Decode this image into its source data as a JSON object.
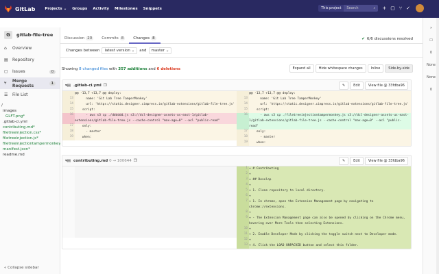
{
  "topbar": {
    "brand": "GitLab",
    "nav": [
      "Projects ⌄",
      "Groups",
      "Activity",
      "Milestones",
      "Snippets"
    ],
    "this_project": "This project",
    "search_placeholder": "Search"
  },
  "sidebar": {
    "project_initial": "G",
    "project_name": "gitlab-file-tree",
    "items": [
      {
        "label": "Overview",
        "icon": "home-icon"
      },
      {
        "label": "Repository",
        "icon": "repo-icon"
      },
      {
        "label": "Issues",
        "count": "0",
        "icon": "issues-icon"
      },
      {
        "label": "Merge Requests",
        "count": "1",
        "icon": "merge-request-icon"
      },
      {
        "label": "File List",
        "icon": "file-list-icon"
      }
    ],
    "tree": [
      {
        "name": "/"
      },
      {
        "name": "images"
      },
      {
        "name": "GLFT.png*"
      },
      {
        "name": ".gitlab-ci.yml"
      },
      {
        "name": "contributing.md*"
      },
      {
        "name": "filetreeinjection.css*"
      },
      {
        "name": "filetreeinjection.js*"
      },
      {
        "name": "filetreeinjectiontampermonkey"
      },
      {
        "name": "manifest.json*"
      },
      {
        "name": "readme.md"
      }
    ],
    "collapse": "Collapse sidebar"
  },
  "tabs": [
    {
      "label": "Discussion",
      "count": "20"
    },
    {
      "label": "Commits",
      "count": "8"
    },
    {
      "label": "Changes",
      "count": "8"
    }
  ],
  "resolved": "6/6 discussions resolved",
  "changesbar": {
    "between": "Changes between",
    "version": "latest version ⌄",
    "and": "and",
    "target": "master ⌄"
  },
  "stats": {
    "prefix": "Showing",
    "changed": "8 changed files",
    "mid": "with",
    "additions": "357 additions",
    "and": "and",
    "deletions": "6 deletions"
  },
  "buttons": {
    "expand_all": "Expand all",
    "hide_ws": "Hide whitespace changes",
    "inline": "Inline",
    "side": "Side-by-side"
  },
  "file1": {
    "name": ".gitlab-ci.yml",
    "edit": "Edit",
    "view": "View file @ 33fdba96",
    "left": [
      {
        "ln": "",
        "type": "ctx",
        "code": "@@ -13,7 +13,7 @@ deploy:"
      },
      {
        "ln": "13",
        "type": "ctx",
        "code": "      name: 'Git Lab Tree TamperMonkey'"
      },
      {
        "ln": "14",
        "type": "ctx",
        "code": "      url: 'https://static.designer.cimpress.io/gitlab-extensions/gitlab-file-tree.js'"
      },
      {
        "ln": "15",
        "type": "ctx",
        "code": "    script:"
      },
      {
        "ln": "16",
        "type": "old",
        "code": "      - aws s3 cp ./dddddd.js s3://dcl-designer-assets-us-east-1/gitlab-extensions/gitlab-file-tree.js --cache-control \"max-age=0\" --acl \"public-read\""
      },
      {
        "ln": "17",
        "type": "ctx",
        "code": "    only:"
      },
      {
        "ln": "18",
        "type": "ctx",
        "code": "      - master"
      },
      {
        "ln": "19",
        "type": "ctx",
        "code": "    when:"
      }
    ],
    "right": [
      {
        "ln": "",
        "type": "ctx",
        "code": "@@ -13,7 +13,7 @@ deploy:"
      },
      {
        "ln": "13",
        "type": "ctx",
        "code": "      name: 'Git Lab Tree TamperMonkey'"
      },
      {
        "ln": "14",
        "type": "ctx",
        "code": "      url: 'https://static.designer.cimpress.io/gitlab-extensions/gitlab-file-tree.js'"
      },
      {
        "ln": "15",
        "type": "ctx",
        "code": "    script:"
      },
      {
        "ln": "16",
        "type": "new",
        "code": "      - aws s3 cp ./filetreeinjectiontampermonkey.js s3://dcl-designer-assets-us-east-1/gitlab-extensions/gitlab-file-tree.js --cache-control \"max-age=0\" --acl \"public-read\""
      },
      {
        "ln": "17",
        "type": "ctx",
        "code": "    only:"
      },
      {
        "ln": "18",
        "type": "ctx",
        "code": "      - master"
      },
      {
        "ln": "19",
        "type": "ctx",
        "code": "    when:"
      }
    ]
  },
  "file2": {
    "name": "contributing.md",
    "mode": "0 → 100644",
    "edit": "Edit",
    "view": "View file @ 33fdba96",
    "right": [
      {
        "ln": "1",
        "code": "+ # Contributing"
      },
      {
        "ln": "2",
        "code": "+"
      },
      {
        "ln": "3",
        "code": "+ ## Develop"
      },
      {
        "ln": "4",
        "code": "+"
      },
      {
        "ln": "5",
        "code": "+ 1. Clone repository to local directory."
      },
      {
        "ln": "6",
        "code": "+"
      },
      {
        "ln": "7",
        "code": "+ 1. In chrome, open the Extension Management page by navigating to chrome://extensions."
      },
      {
        "ln": "8",
        "code": "+"
      },
      {
        "ln": "9",
        "code": "+ - The Extension Management page can also be opened by clicking on the Chrome menu, hovering over More Tools then selecting Extensions."
      },
      {
        "ln": "10",
        "code": "+"
      },
      {
        "ln": "11",
        "code": "+ 2. Enable Developer Mode by clicking the toggle switch next to Developer mode."
      },
      {
        "ln": "12",
        "code": "+"
      },
      {
        "ln": "13",
        "code": "+ 4. Click the LOAD UNPACKED button and select this folder."
      }
    ]
  },
  "rightbar": [
    "0",
    "None",
    "None",
    "0"
  ]
}
